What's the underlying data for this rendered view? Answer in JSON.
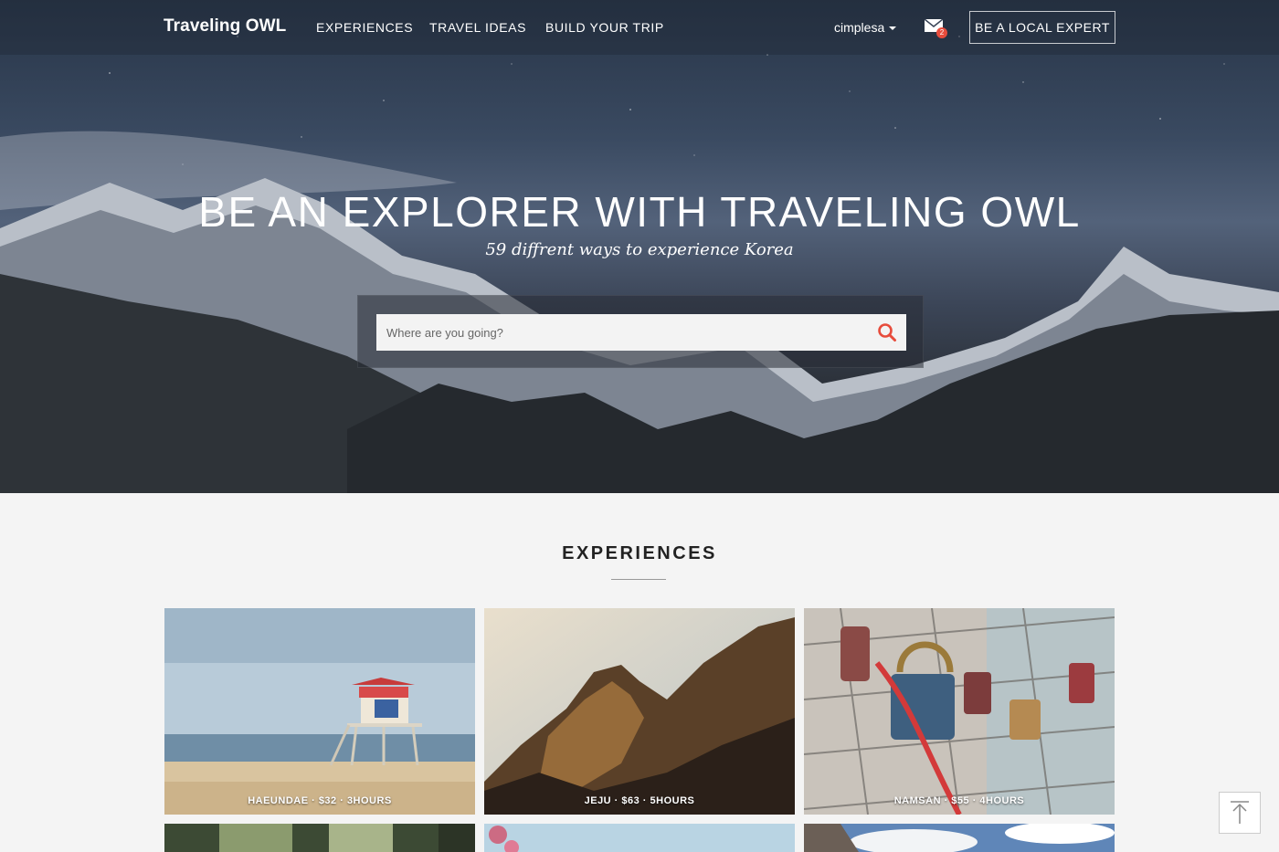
{
  "nav": {
    "brand": "Traveling OWL",
    "links": [
      "EXPERIENCES",
      "TRAVEL IDEAS",
      "BUILD YOUR TRIP"
    ],
    "user": "cimplesa",
    "mail_count": "2",
    "local_expert_label": "BE A LOCAL EXPERT"
  },
  "hero": {
    "title": "BE AN EXPLORER WITH TRAVELING OWL",
    "subtitle": "59 diffrent ways to experience Korea",
    "search_placeholder": "Where are you going?"
  },
  "experiences": {
    "title": "EXPERIENCES",
    "cards": [
      {
        "caption": "HAEUNDAE · $32 · 3HOURS"
      },
      {
        "caption": "JEJU · $63 · 5HOURS"
      },
      {
        "caption": "NAMSAN · $55 · 4HOURS"
      }
    ]
  },
  "colors": {
    "accent": "#e74c3c",
    "section_bg": "#f4f4f4",
    "nav_text": "#ffffff"
  },
  "icons": {
    "search": "search-icon",
    "mail": "mail-icon",
    "back_to_top": "arrow-up-icon"
  }
}
